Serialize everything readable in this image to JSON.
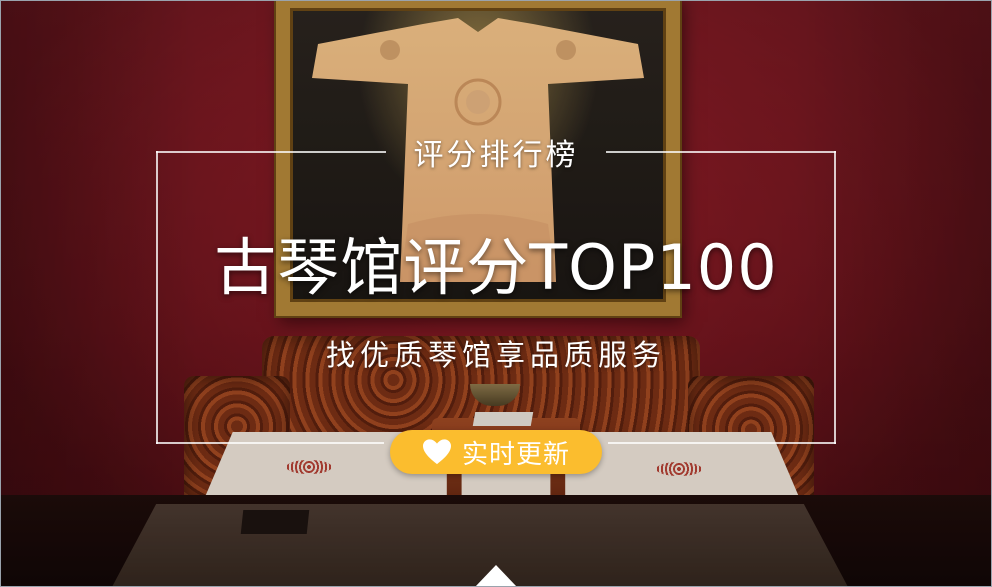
{
  "banner": {
    "top_label": "评分排行榜",
    "headline": "古琴馆评分TOP100",
    "subline": "找优质琴馆享品质服务",
    "badge_label": "实时更新"
  },
  "colors": {
    "wall": "#8e1c26",
    "badge": "#fbbd2e",
    "text": "#ffffff",
    "frame_gold": "#b58a3b"
  },
  "icons": {
    "badge_icon": "heart-icon",
    "bottom_indicator": "caret-up-icon"
  }
}
